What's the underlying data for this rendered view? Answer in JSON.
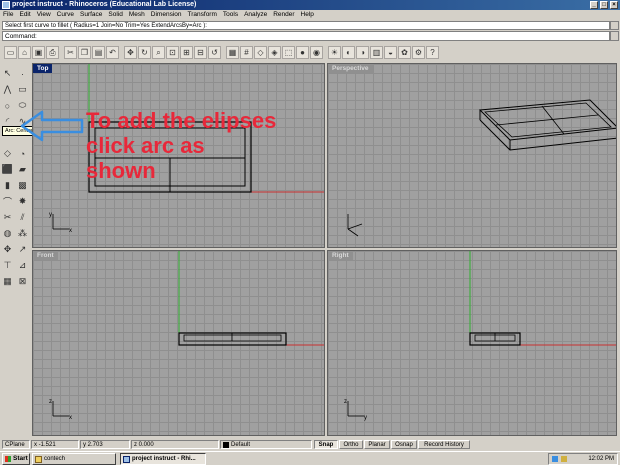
{
  "window": {
    "title": "project instruct - Rhinoceros (Educational Lab License)",
    "buttons": [
      "_",
      "□",
      "×"
    ]
  },
  "menu": [
    "File",
    "Edit",
    "View",
    "Curve",
    "Surface",
    "Solid",
    "Mesh",
    "Dimension",
    "Transform",
    "Tools",
    "Analyze",
    "Render",
    "Help"
  ],
  "command": {
    "history": "Select first curve to fillet ( Radius=1  Join=No  Trim=Yes  ExtendArcsBy=Arc ):",
    "prompt": "Command:"
  },
  "tooltip": "Arc: Center, start, angle",
  "annotation": {
    "line1": "To add the elipses",
    "line2": "click arc as",
    "line3": "shown"
  },
  "viewports": {
    "top": "Top",
    "perspective": "Perspective",
    "front": "Front",
    "right": "Right"
  },
  "axes": {
    "x": "x",
    "y": "y",
    "z": "z"
  },
  "statusbar": {
    "cplane": "CPlane",
    "x": "x -1.521",
    "y": "y 2.703",
    "z": "z 0.000",
    "layer": "Default",
    "snap": "Snap",
    "ortho": "Ortho",
    "planar": "Planar",
    "osnap": "Osnap",
    "record": "Record History"
  },
  "taskbar": {
    "start": "Start",
    "task1": "contech",
    "task2": "project instruct - Rhi...",
    "clock": "12:02 PM"
  },
  "colors": {
    "annotation": "#e8283a",
    "arrow": "#3a8ee0",
    "x_axis": "#c83030",
    "y_axis": "#30b030",
    "titlebar": "#0a246a"
  }
}
